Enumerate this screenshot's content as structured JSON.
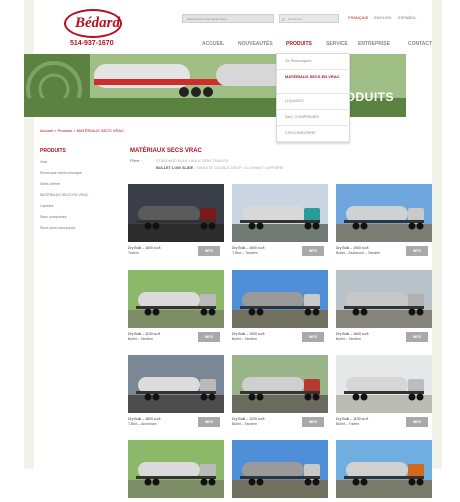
{
  "brand": {
    "logo_text": "Bédard",
    "phone": "514-937-1670"
  },
  "header": {
    "select_value": "Sélectionnez une équipement",
    "search_placeholder": "Recherche",
    "links": [
      "FRANÇAIS",
      "ENGLISH",
      "ESPAÑOL"
    ]
  },
  "nav": [
    "ACCUEIL",
    "NOUVEAUTÉS",
    "PRODUITS",
    "SERVICE",
    "ENTREPRISE",
    "CONTACT"
  ],
  "banner": {
    "title": "PRODUITS"
  },
  "dropdown": [
    "Sc Remorques",
    "MATÉRIAUX SECS EN VRAC",
    "LIQUIDES",
    "SAC COMPRIMÉS",
    "CIRCONSCRIRE"
  ],
  "breadcrumb": "Accueil > Produits > MATÉRIAUX SECS VRAC",
  "sidebar": {
    "title": "PRODUITS",
    "items": [
      "Vrac",
      "Remorque semi-remorque",
      "Semi-citerne",
      "MATÉRIAUX SECS EN VRAC",
      "Liquides",
      "Sacs comprimés",
      "Semi-semi-remorques"
    ]
  },
  "content": {
    "title": "MATÉRIAUX SECS VRAC",
    "filter_label": "Filtrer :",
    "filter_row1": "STANDARD BULK  •  BULK SEMI-TRAILER",
    "filter_row2_active": "BULLET LOW SLIDE",
    "filter_row2_rest": "  •  GRAVITÉ DOUBLE DROP  •  À L'AVANT  •  ARRIÈRE"
  },
  "products": [
    {
      "caption": "Dry Bulk – 1600 cu.ft",
      "sub": "Tridem",
      "button": "INFO",
      "theme": "dark"
    },
    {
      "caption": "Dry Bulk – 1600 cu.ft",
      "sub": "T-Bird – Tandem",
      "button": "INFO",
      "theme": "silver-teal"
    },
    {
      "caption": "Dry Bulk – 1900 cu.ft",
      "sub": "Bullet – Aluminum – Tandem",
      "button": "INFO",
      "theme": "sky-long"
    },
    {
      "caption": "Dry Bulk – 1100 cu.ft",
      "sub": "Bullet – Tandem",
      "button": "INFO",
      "theme": "trees"
    },
    {
      "caption": "Dry Bulk – 1000 cu.ft",
      "sub": "Bullet – Tandem",
      "button": "INFO",
      "theme": "sky-short"
    },
    {
      "caption": "Dry Bulk – 1600 cu.ft",
      "sub": "Bullet – Tandem",
      "button": "INFO",
      "theme": "grey"
    },
    {
      "caption": "Dry Bulk – 1800 cu.ft",
      "sub": "T-Bird – Aluminum",
      "button": "INFO",
      "theme": "dusk"
    },
    {
      "caption": "Dry Bulk – 1200 cu.ft",
      "sub": "Bullet – Tandem",
      "button": "INFO",
      "theme": "red-trees"
    },
    {
      "caption": "Dry Bulk – 1100 cu.ft",
      "sub": "Bullet – Tridem",
      "button": "INFO",
      "theme": "light"
    },
    {
      "caption": "",
      "sub": "",
      "button": "",
      "theme": "trees"
    },
    {
      "caption": "",
      "sub": "",
      "button": "",
      "theme": "sky-short"
    },
    {
      "caption": "",
      "sub": "",
      "button": "",
      "theme": "orange"
    }
  ],
  "colors": {
    "accent": "#b3121e",
    "banner_green": "#5c8241",
    "button_grey": "#a9a9a9"
  }
}
